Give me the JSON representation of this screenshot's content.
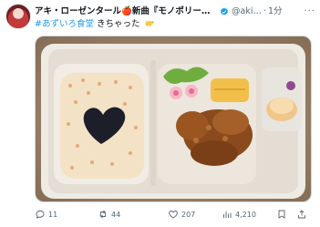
{
  "author": {
    "display_name": "アキ・ローゼンタール🍎新曲『モノポリー』リリ…",
    "handle": "@aki…",
    "separator": "·",
    "time": "1分",
    "verified_color": "#1d9bf0"
  },
  "tweet": {
    "hashtag": "#あずいろ食堂",
    "text": "きちゃった",
    "emoji": "sparkling-hand-emoji"
  },
  "metrics": {
    "replies": "11",
    "retweets": "44",
    "likes": "207",
    "views": "4,210"
  },
  "colors": {
    "accent": "#1d9bf0",
    "text": "#0f1419",
    "muted": "#536471"
  }
}
